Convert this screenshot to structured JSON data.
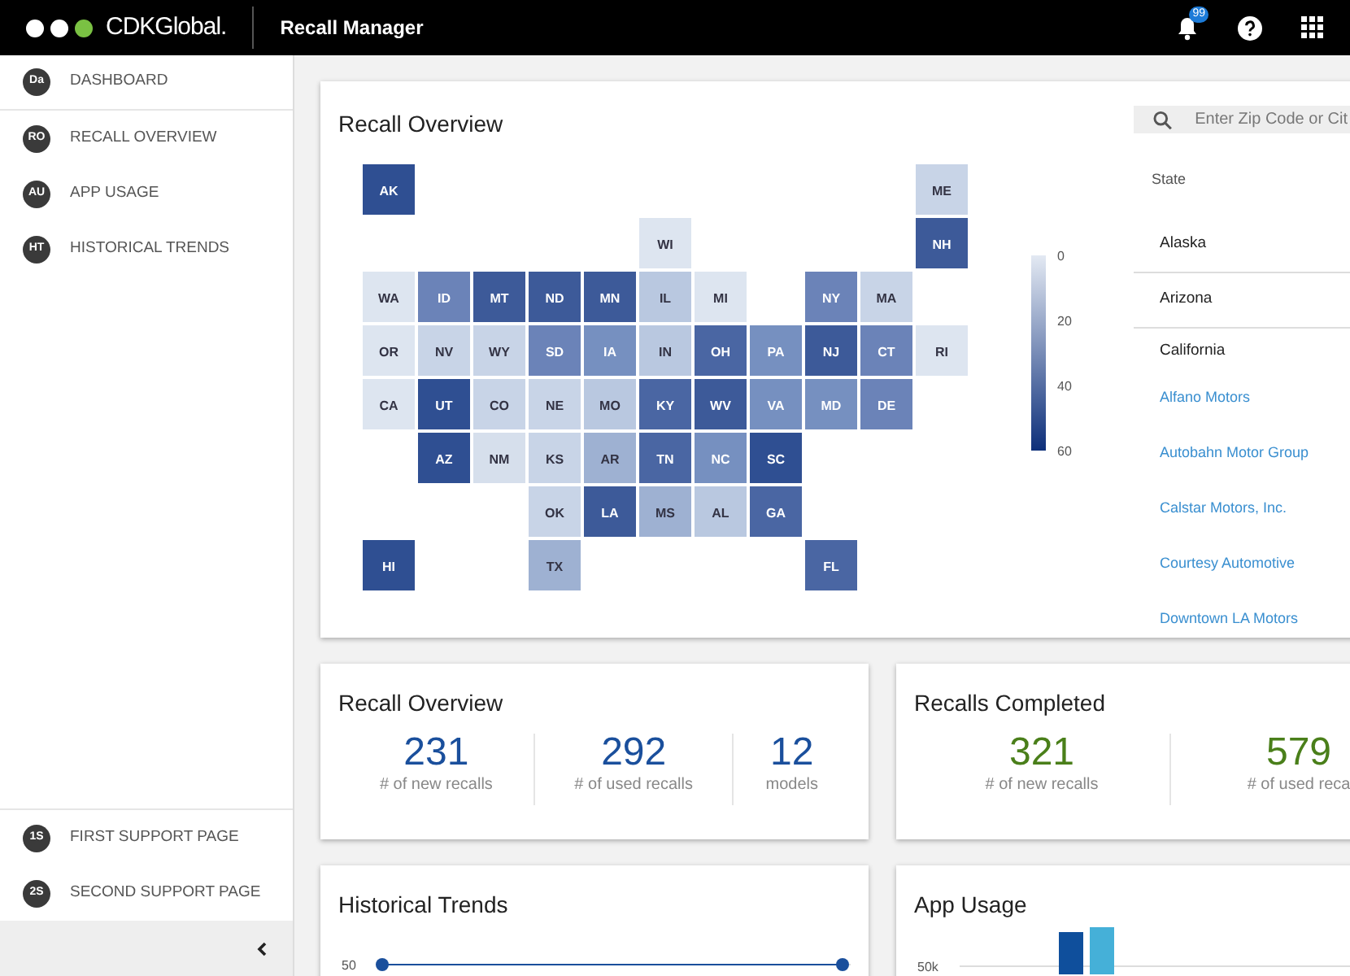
{
  "header": {
    "brand": "CDKGlobal.",
    "app_title": "Recall Manager",
    "notifications": "99"
  },
  "sidebar": {
    "items": [
      {
        "abbr": "Da",
        "label": "DASHBOARD",
        "selected": true
      },
      {
        "abbr": "RO",
        "label": "RECALL OVERVIEW",
        "selected": false
      },
      {
        "abbr": "AU",
        "label": "APP USAGE",
        "selected": false
      },
      {
        "abbr": "HT",
        "label": "HISTORICAL TRENDS",
        "selected": false
      }
    ],
    "support_items": [
      {
        "abbr": "1S",
        "label": "FIRST SUPPORT PAGE"
      },
      {
        "abbr": "2S",
        "label": "SECOND SUPPORT PAGE"
      }
    ]
  },
  "map_card": {
    "title": "Recall Overview",
    "states": [
      {
        "code": "AK",
        "color": "#2f4f92"
      },
      {
        "code": "ME",
        "color": "#c8d4e7"
      },
      {
        "code": "WI",
        "color": "#dde5f0"
      },
      {
        "code": "NH",
        "color": "#3d5a99"
      },
      {
        "code": "WA",
        "color": "#dde5f0"
      },
      {
        "code": "ID",
        "color": "#6b83b8"
      },
      {
        "code": "MT",
        "color": "#3d5a99"
      },
      {
        "code": "ND",
        "color": "#3d5a99"
      },
      {
        "code": "MN",
        "color": "#3d5a99"
      },
      {
        "code": "IL",
        "color": "#b9c8e0"
      },
      {
        "code": "MI",
        "color": "#dde5f0"
      },
      {
        "code": "NY",
        "color": "#6b83b8"
      },
      {
        "code": "MA",
        "color": "#c8d4e7"
      },
      {
        "code": "OR",
        "color": "#dde5f0"
      },
      {
        "code": "NV",
        "color": "#c8d4e7"
      },
      {
        "code": "WY",
        "color": "#c8d4e7"
      },
      {
        "code": "SD",
        "color": "#6b83b8"
      },
      {
        "code": "IA",
        "color": "#7690c0"
      },
      {
        "code": "IN",
        "color": "#b9c8e0"
      },
      {
        "code": "OH",
        "color": "#4a66a3"
      },
      {
        "code": "PA",
        "color": "#7690c0"
      },
      {
        "code": "NJ",
        "color": "#3d5a99"
      },
      {
        "code": "CT",
        "color": "#6b83b8"
      },
      {
        "code": "RI",
        "color": "#dde5f0"
      },
      {
        "code": "CA",
        "color": "#dde5f0"
      },
      {
        "code": "UT",
        "color": "#2f4f92"
      },
      {
        "code": "CO",
        "color": "#c8d4e7"
      },
      {
        "code": "NE",
        "color": "#c8d4e7"
      },
      {
        "code": "MO",
        "color": "#b9c8e0"
      },
      {
        "code": "KY",
        "color": "#4a66a3"
      },
      {
        "code": "WV",
        "color": "#3d5a99"
      },
      {
        "code": "VA",
        "color": "#7690c0"
      },
      {
        "code": "MD",
        "color": "#7690c0"
      },
      {
        "code": "DE",
        "color": "#6b83b8"
      },
      {
        "code": "AZ",
        "color": "#2f4f92"
      },
      {
        "code": "NM",
        "color": "#d6dfec"
      },
      {
        "code": "KS",
        "color": "#c8d4e7"
      },
      {
        "code": "AR",
        "color": "#9eb1d2"
      },
      {
        "code": "TN",
        "color": "#4a66a3"
      },
      {
        "code": "NC",
        "color": "#7690c0"
      },
      {
        "code": "SC",
        "color": "#2f4f92"
      },
      {
        "code": "OK",
        "color": "#c8d4e7"
      },
      {
        "code": "LA",
        "color": "#3d5a99"
      },
      {
        "code": "MS",
        "color": "#9eb1d2"
      },
      {
        "code": "AL",
        "color": "#b9c8e0"
      },
      {
        "code": "GA",
        "color": "#4a66a3"
      },
      {
        "code": "HI",
        "color": "#2f4f92"
      },
      {
        "code": "TX",
        "color": "#9eb1d2"
      },
      {
        "code": "FL",
        "color": "#4a66a3"
      }
    ],
    "legend": {
      "ticks": [
        "0",
        "20",
        "40",
        "60"
      ]
    },
    "search": {
      "placeholder": "Enter Zip Code or Cit"
    },
    "list_header": "State",
    "list": [
      {
        "name": "Alaska",
        "expanded": false
      },
      {
        "name": "Arizona",
        "expanded": false
      },
      {
        "name": "California",
        "expanded": true,
        "children": [
          "Alfano Motors",
          "Autobahn Motor Group",
          "Calstar Motors, Inc.",
          "Courtesy Automotive",
          "Downtown LA Motors"
        ]
      }
    ]
  },
  "stat_cards": [
    {
      "title": "Recall Overview",
      "color": "#1a4f9c",
      "stats": [
        {
          "value": "231",
          "label": "# of new recalls"
        },
        {
          "value": "292",
          "label": "# of used recalls"
        },
        {
          "value": "12",
          "label": "models"
        }
      ]
    },
    {
      "title": "Recalls Completed",
      "color": "#4a7f1a",
      "stats": [
        {
          "value": "321",
          "label": "# of new recalls"
        },
        {
          "value": "579",
          "label": "# of used reca"
        }
      ]
    }
  ],
  "chart_cards": [
    {
      "title": "Historical Trends",
      "kind": "line",
      "tick": "50"
    },
    {
      "title": "App Usage",
      "kind": "bar",
      "tick": "50k"
    }
  ]
}
